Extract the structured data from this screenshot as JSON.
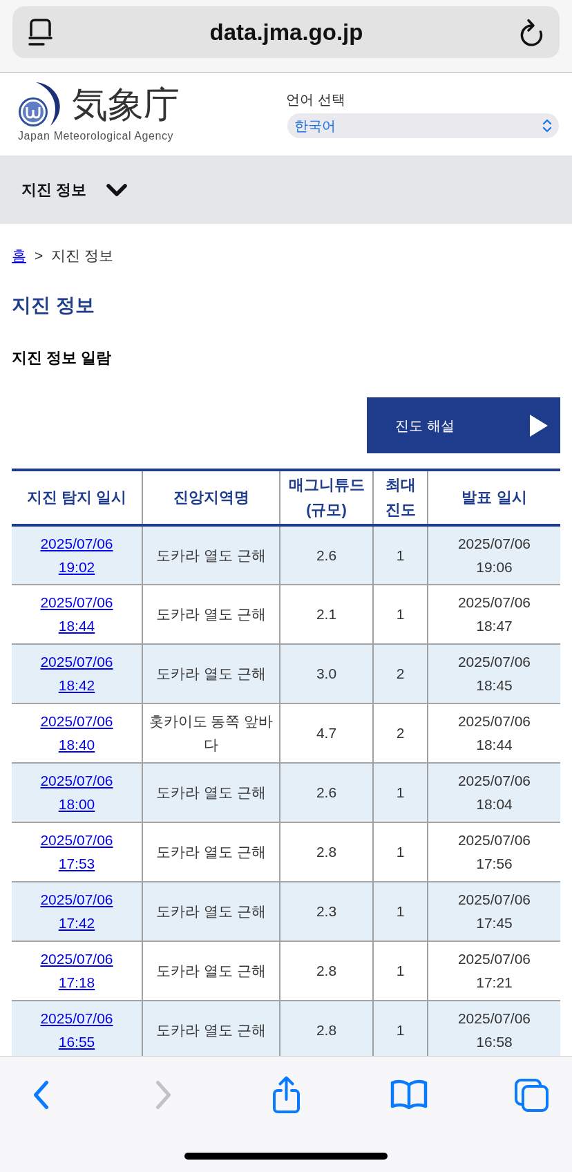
{
  "browser": {
    "url": "data.jma.go.jp"
  },
  "header": {
    "logo": {
      "name": "気象庁",
      "subtitle": "Japan Meteorological Agency"
    },
    "language": {
      "label": "언어 선택",
      "value": "한국어"
    }
  },
  "nav": {
    "label": "지진 정보",
    "expanded": false
  },
  "breadcrumb": [
    {
      "kind": "link",
      "label": "홈"
    },
    {
      "kind": "separator",
      "label": ">"
    },
    {
      "kind": "current",
      "label": "지진 정보"
    }
  ],
  "page_title": "지진 정보",
  "section_title": "지진 정보 일람",
  "guide_button": {
    "label": "진도 해설"
  },
  "table": {
    "columns": [
      "지진 탐지 일시",
      "진앙지역명",
      "매그니튜드 (규모)",
      "최대 진도",
      "발표 일시"
    ],
    "rows": [
      {
        "detected_date": "2025/07/06",
        "detected_time": "19:02",
        "region": "도카라 열도 근해",
        "magnitude": "2.6",
        "max_intensity": "1",
        "announced_date": "2025/07/06",
        "announced_time": "19:06"
      },
      {
        "detected_date": "2025/07/06",
        "detected_time": "18:44",
        "region": "도카라 열도 근해",
        "magnitude": "2.1",
        "max_intensity": "1",
        "announced_date": "2025/07/06",
        "announced_time": "18:47"
      },
      {
        "detected_date": "2025/07/06",
        "detected_time": "18:42",
        "region": "도카라 열도 근해",
        "magnitude": "3.0",
        "max_intensity": "2",
        "announced_date": "2025/07/06",
        "announced_time": "18:45"
      },
      {
        "detected_date": "2025/07/06",
        "detected_time": "18:40",
        "region": "홋카이도 동쪽 앞바다",
        "magnitude": "4.7",
        "max_intensity": "2",
        "announced_date": "2025/07/06",
        "announced_time": "18:44"
      },
      {
        "detected_date": "2025/07/06",
        "detected_time": "18:00",
        "region": "도카라 열도 근해",
        "magnitude": "2.6",
        "max_intensity": "1",
        "announced_date": "2025/07/06",
        "announced_time": "18:04"
      },
      {
        "detected_date": "2025/07/06",
        "detected_time": "17:53",
        "region": "도카라 열도 근해",
        "magnitude": "2.8",
        "max_intensity": "1",
        "announced_date": "2025/07/06",
        "announced_time": "17:56"
      },
      {
        "detected_date": "2025/07/06",
        "detected_time": "17:42",
        "region": "도카라 열도 근해",
        "magnitude": "2.3",
        "max_intensity": "1",
        "announced_date": "2025/07/06",
        "announced_time": "17:45"
      },
      {
        "detected_date": "2025/07/06",
        "detected_time": "17:18",
        "region": "도카라 열도 근해",
        "magnitude": "2.8",
        "max_intensity": "1",
        "announced_date": "2025/07/06",
        "announced_time": "17:21"
      },
      {
        "detected_date": "2025/07/06",
        "detected_time": "16:55",
        "region": "도카라 열도 근해",
        "magnitude": "2.8",
        "max_intensity": "1",
        "announced_date": "2025/07/06",
        "announced_time": "16:58"
      }
    ]
  },
  "toolbar": {
    "buttons": [
      {
        "kind": "back",
        "disabled": false
      },
      {
        "kind": "forward",
        "disabled": true
      },
      {
        "kind": "share",
        "disabled": false
      },
      {
        "kind": "bookmarks",
        "disabled": false
      },
      {
        "kind": "tabs",
        "disabled": false
      }
    ]
  }
}
